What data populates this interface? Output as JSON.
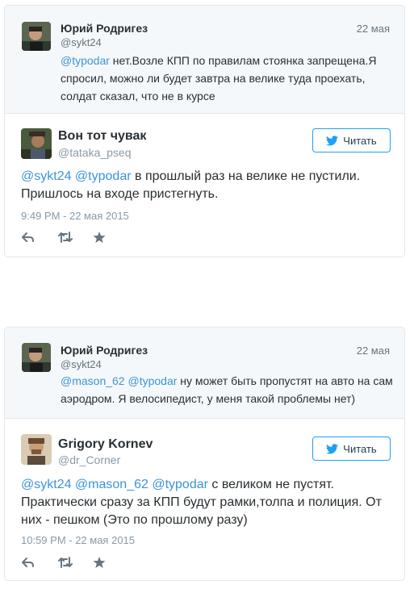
{
  "tweets": [
    {
      "quoted": {
        "name": "Юрий Родригез",
        "handle": "@sykt24",
        "date": "22 мая",
        "mention": "@typodar",
        "text": " нет.Возле КПП по правилам стоянка запрещена.Я спросил, можно ли будет завтра на велике туда проехать, солдат сказал, что не в курсе"
      },
      "main": {
        "name": "Вон тот чувак",
        "handle": "@tataka_pseq",
        "follow_label": "Читать",
        "mentions": "@sykt24 @typodar",
        "text": " в прошлый раз на велике не пустили. Пришлось на входе пристегнуть.",
        "time": "9:49 PM - 22 мая 2015"
      }
    },
    {
      "quoted": {
        "name": "Юрий Родригез",
        "handle": "@sykt24",
        "date": "22 мая",
        "mention": "@mason_62 @typodar",
        "text": " ну может быть пропустят на авто на сам аэродром. Я велосипедист, у меня такой проблемы нет)"
      },
      "main": {
        "name": "Grigory Kornev",
        "handle": "@dr_Corner",
        "follow_label": "Читать",
        "mentions": "@sykt24 @mason_62 @typodar",
        "text": " с великом не пустят. Практически сразу за КПП будут рамки,толпа и полиция. От них - пешком (Это по прошлому разу)",
        "time": "10:59 PM - 22 мая 2015"
      }
    }
  ],
  "icons": {
    "reply": "reply-icon",
    "retweet": "retweet-icon",
    "favorite": "star-icon",
    "follow": "twitter-bird-icon"
  },
  "colors": {
    "link": "#3b94d9",
    "border": "#e1e8ed",
    "quote_bg": "#f5f8fa",
    "follow_border": "#1da1f2",
    "muted": "#8899a6"
  }
}
